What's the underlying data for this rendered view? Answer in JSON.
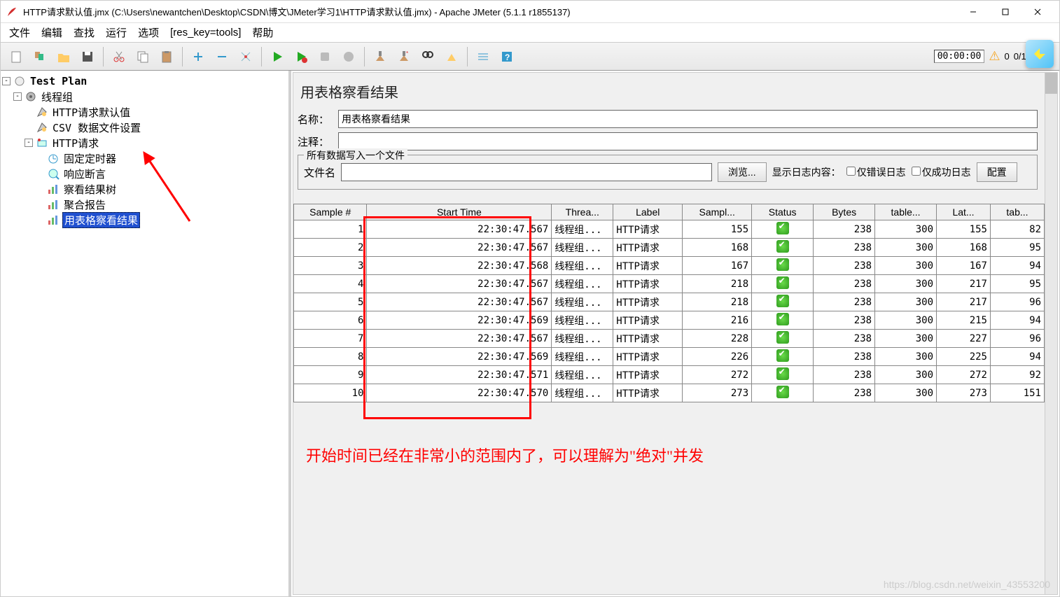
{
  "titlebar": {
    "title": "HTTP请求默认值.jmx (C:\\Users\\newantchen\\Desktop\\CSDN\\博文\\JMeter学习1\\HTTP请求默认值.jmx) - Apache JMeter (5.1.1 r1855137)"
  },
  "menubar": {
    "items": [
      "文件",
      "编辑",
      "查找",
      "运行",
      "选项",
      "[res_key=tools]",
      "帮助"
    ]
  },
  "toolbar_right": {
    "timer": "00:00:00",
    "warn_count": "0",
    "ratio": "0/10"
  },
  "tree": {
    "root": "Test Plan",
    "items": [
      {
        "label": "线程组",
        "indent": 1,
        "toggle": "-",
        "icon": "gear"
      },
      {
        "label": "HTTP请求默认值",
        "indent": 2,
        "icon": "config"
      },
      {
        "label": "CSV 数据文件设置",
        "indent": 2,
        "icon": "config"
      },
      {
        "label": "HTTP请求",
        "indent": 2,
        "toggle": "-",
        "icon": "sampler"
      },
      {
        "label": "固定定时器",
        "indent": 3,
        "icon": "timer"
      },
      {
        "label": "响应断言",
        "indent": 3,
        "icon": "assertion"
      },
      {
        "label": "察看结果树",
        "indent": 3,
        "icon": "listener"
      },
      {
        "label": "聚合报告",
        "indent": 3,
        "icon": "listener"
      },
      {
        "label": "用表格察看结果",
        "indent": 3,
        "icon": "listener",
        "selected": true
      }
    ]
  },
  "panel": {
    "title": "用表格察看结果",
    "name_label": "名称：",
    "name_value": "用表格察看结果",
    "comment_label": "注释：",
    "comment_value": "",
    "fieldset_legend": "所有数据写入一个文件",
    "file_label": "文件名",
    "file_value": "",
    "browse": "浏览...",
    "loglabel": "显示日志内容：",
    "chk_error": "仅错误日志",
    "chk_success": "仅成功日志",
    "configure": "配置"
  },
  "table": {
    "headers": [
      "Sample #",
      "Start Time",
      "Threa...",
      "Label",
      "Sampl...",
      "Status",
      "Bytes",
      "table...",
      "Lat...",
      "tab..."
    ],
    "rows": [
      {
        "n": 1,
        "start": "22:30:47.567",
        "thread": "线程组...",
        "label": "HTTP请求",
        "sample": 155,
        "bytes": 238,
        "t": 300,
        "lat": 155,
        "tab": 82
      },
      {
        "n": 2,
        "start": "22:30:47.567",
        "thread": "线程组...",
        "label": "HTTP请求",
        "sample": 168,
        "bytes": 238,
        "t": 300,
        "lat": 168,
        "tab": 95
      },
      {
        "n": 3,
        "start": "22:30:47.568",
        "thread": "线程组...",
        "label": "HTTP请求",
        "sample": 167,
        "bytes": 238,
        "t": 300,
        "lat": 167,
        "tab": 94
      },
      {
        "n": 4,
        "start": "22:30:47.567",
        "thread": "线程组...",
        "label": "HTTP请求",
        "sample": 218,
        "bytes": 238,
        "t": 300,
        "lat": 217,
        "tab": 95
      },
      {
        "n": 5,
        "start": "22:30:47.567",
        "thread": "线程组...",
        "label": "HTTP请求",
        "sample": 218,
        "bytes": 238,
        "t": 300,
        "lat": 217,
        "tab": 96
      },
      {
        "n": 6,
        "start": "22:30:47.569",
        "thread": "线程组...",
        "label": "HTTP请求",
        "sample": 216,
        "bytes": 238,
        "t": 300,
        "lat": 215,
        "tab": 94
      },
      {
        "n": 7,
        "start": "22:30:47.567",
        "thread": "线程组...",
        "label": "HTTP请求",
        "sample": 228,
        "bytes": 238,
        "t": 300,
        "lat": 227,
        "tab": 96
      },
      {
        "n": 8,
        "start": "22:30:47.569",
        "thread": "线程组...",
        "label": "HTTP请求",
        "sample": 226,
        "bytes": 238,
        "t": 300,
        "lat": 225,
        "tab": 94
      },
      {
        "n": 9,
        "start": "22:30:47.571",
        "thread": "线程组...",
        "label": "HTTP请求",
        "sample": 272,
        "bytes": 238,
        "t": 300,
        "lat": 272,
        "tab": 92
      },
      {
        "n": 10,
        "start": "22:30:47.570",
        "thread": "线程组...",
        "label": "HTTP请求",
        "sample": 273,
        "bytes": 238,
        "t": 300,
        "lat": 273,
        "tab": 151
      }
    ]
  },
  "annotation": "开始时间已经在非常小的范围内了，可以理解为\"绝对\"并发",
  "watermark": "https://blog.csdn.net/weixin_43553200"
}
